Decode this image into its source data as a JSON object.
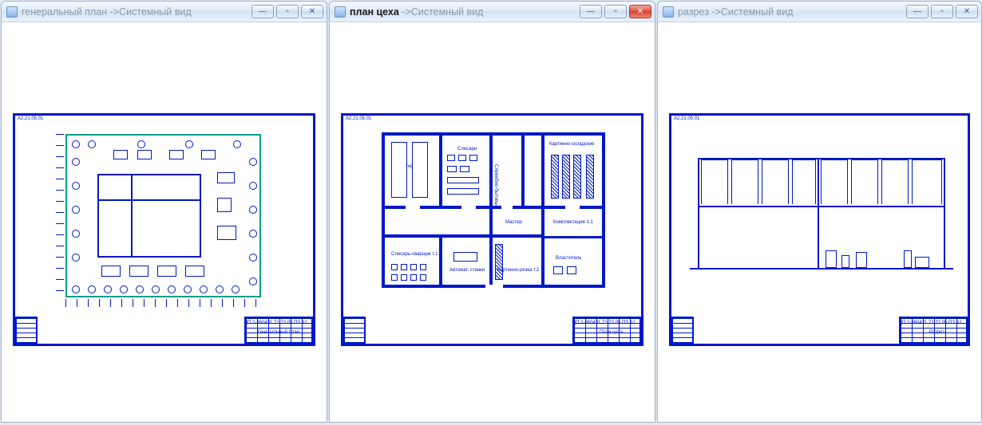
{
  "windows": [
    {
      "id": "w1",
      "focused": false,
      "title_name": "генеральный план",
      "title_suffix": " ->Системный вид",
      "buttons": {
        "min": "—",
        "max": "▫",
        "close": "✕"
      }
    },
    {
      "id": "w2",
      "focused": true,
      "title_name": "план цеха",
      "title_suffix": " ->Системный вид",
      "buttons": {
        "min": "—",
        "max": "▫",
        "close": "✕"
      }
    },
    {
      "id": "w3",
      "focused": false,
      "title_name": "разрез",
      "title_suffix": " ->Системный вид",
      "buttons": {
        "min": "—",
        "max": "▫",
        "close": "✕"
      }
    }
  ],
  "sheet1": {
    "stamp_title": "Генеральный план",
    "stamp_code": "ДП 2-360431.71.72.05.ПЗ А1",
    "corner_top": "А2.21.05.01"
  },
  "sheet2": {
    "stamp_title": "План цеха",
    "stamp_code": "ДП 2-360431.71.72.05.ПЗ А1",
    "corner_top": "А2.21.05.01",
    "rooms": {
      "r1": "Материал.",
      "r2": "Слесари",
      "r3": "Служебно-бытовые",
      "r4": "Картинно-складские",
      "r5": "Мастер",
      "r6": "Комплектация п.1",
      "r7": "Слесарь-сварщик т.1",
      "r8": "Автомат. станки",
      "r9": "Картинно-резка т.2",
      "r10": "Властитель"
    }
  },
  "sheet3": {
    "stamp_title": "Разрез",
    "stamp_code": "ДП 2-360431.71.72.05.ПЗ А1",
    "corner_top": "А2.21.05.01"
  }
}
